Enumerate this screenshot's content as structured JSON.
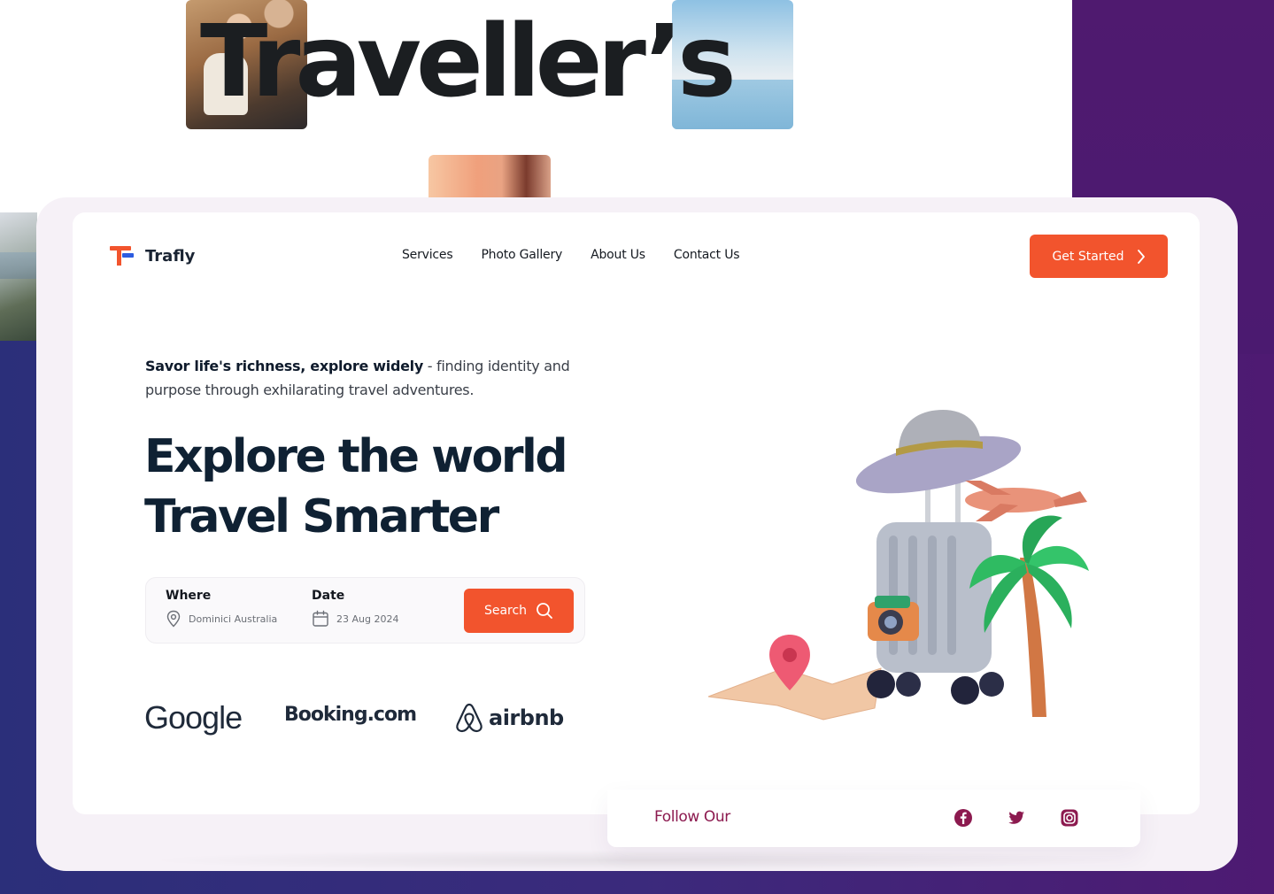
{
  "hero_word": "Traveller’s",
  "brand": {
    "name": "Trafly"
  },
  "nav": {
    "items": [
      "Services",
      "Photo Gallery",
      "About Us",
      "Contact Us"
    ],
    "cta_label": "Get Started"
  },
  "hero": {
    "tagline_bold": "Savor life's richness, explore widely",
    "tagline_rest": " - finding identity and purpose through exhilarating travel adventures.",
    "headline_line1": "Explore the world",
    "headline_line2": "Travel Smarter"
  },
  "search": {
    "where_label": "Where",
    "where_value": "Dominici Australia",
    "date_label": "Date",
    "date_value": "23 Aug 2024",
    "button_label": "Search"
  },
  "partners": {
    "google": "Google",
    "booking": "Booking.com",
    "airbnb": "airbnb"
  },
  "follow": {
    "label": "Follow Our"
  },
  "colors": {
    "accent": "#f2542d",
    "brand_blue": "#2c5ce0",
    "heading": "#0f2133",
    "follow_text": "#8c1a4f",
    "background_purple": "#4e1a72"
  },
  "icons": {
    "cta": "chevron-right-icon",
    "location": "map-pin-icon",
    "date": "calendar-icon",
    "search": "search-icon",
    "social": [
      "facebook-icon",
      "twitter-icon",
      "instagram-icon"
    ]
  }
}
